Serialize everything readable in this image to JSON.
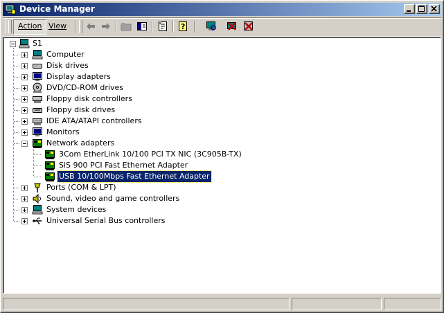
{
  "window": {
    "title": "Device Manager",
    "icon": "device-manager-icon"
  },
  "menu": {
    "action_label": "Action",
    "view_label": "View"
  },
  "toolbar": {
    "buttons": [
      "back-arrow-icon",
      "forward-arrow-icon",
      "up-folder-icon",
      "show-hide-tree-icon",
      "properties-icon",
      "help-icon",
      "scan-hardware-icon",
      "disable-device-icon",
      "uninstall-device-icon"
    ]
  },
  "tree": {
    "root": "S1",
    "categories": [
      {
        "label": "Computer",
        "icon": "computer-icon"
      },
      {
        "label": "Disk drives",
        "icon": "disk-drive-icon"
      },
      {
        "label": "Display adapters",
        "icon": "monitor-icon"
      },
      {
        "label": "DVD/CD-ROM drives",
        "icon": "cdrom-icon"
      },
      {
        "label": "Floppy disk controllers",
        "icon": "floppy-controller-icon"
      },
      {
        "label": "Floppy disk drives",
        "icon": "floppy-drive-icon"
      },
      {
        "label": "IDE ATA/ATAPI controllers",
        "icon": "ide-controller-icon"
      },
      {
        "label": "Monitors",
        "icon": "monitor-icon"
      },
      {
        "label": "Network adapters",
        "icon": "network-adapter-icon"
      },
      {
        "label": "Ports (COM & LPT)",
        "icon": "port-icon"
      },
      {
        "label": "Sound, video and game controllers",
        "icon": "sound-icon"
      },
      {
        "label": "System devices",
        "icon": "system-device-icon"
      },
      {
        "label": "Universal Serial Bus controllers",
        "icon": "usb-icon"
      }
    ],
    "network_children": [
      "3Com EtherLink 10/100 PCI TX NIC (3C905B-TX)",
      "SiS 900 PCI Fast Ethernet Adapter",
      "USB 10/100Mbps Fast Ethernet Adapter"
    ],
    "selected": "USB 10/100Mbps Fast Ethernet Adapter"
  },
  "colors": {
    "title_start": "#0a246a",
    "title_end": "#a6caf0",
    "selection": "#0a246a"
  }
}
